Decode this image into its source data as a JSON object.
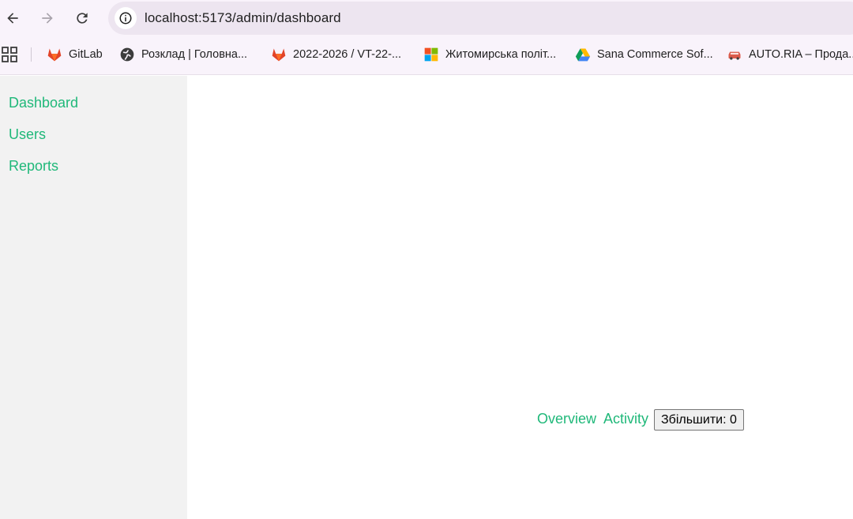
{
  "browser": {
    "url": "localhost:5173/admin/dashboard",
    "bookmarks": [
      {
        "label": "GitLab",
        "icon": "gitlab-icon"
      },
      {
        "label": "Розклад | Головна...",
        "icon": "globe-icon"
      },
      {
        "label": "2022-2026 / VT-22-...",
        "icon": "gitlab-icon"
      },
      {
        "label": "Житомирська політ...",
        "icon": "microsoft-icon"
      },
      {
        "label": "Sana Commerce Sof...",
        "icon": "google-drive-icon"
      },
      {
        "label": "AUTO.RIA – Прода...",
        "icon": "car-icon"
      }
    ]
  },
  "sidebar": {
    "items": [
      {
        "label": "Dashboard"
      },
      {
        "label": "Users"
      },
      {
        "label": "Reports"
      }
    ]
  },
  "main": {
    "links": [
      {
        "label": "Overview"
      },
      {
        "label": "Activity"
      }
    ],
    "increment_button": "Збільшити: 0"
  },
  "colors": {
    "link": "#1fb879",
    "sidebar_bg": "#f2f2f2",
    "chrome_bg": "#f9f3fb"
  }
}
